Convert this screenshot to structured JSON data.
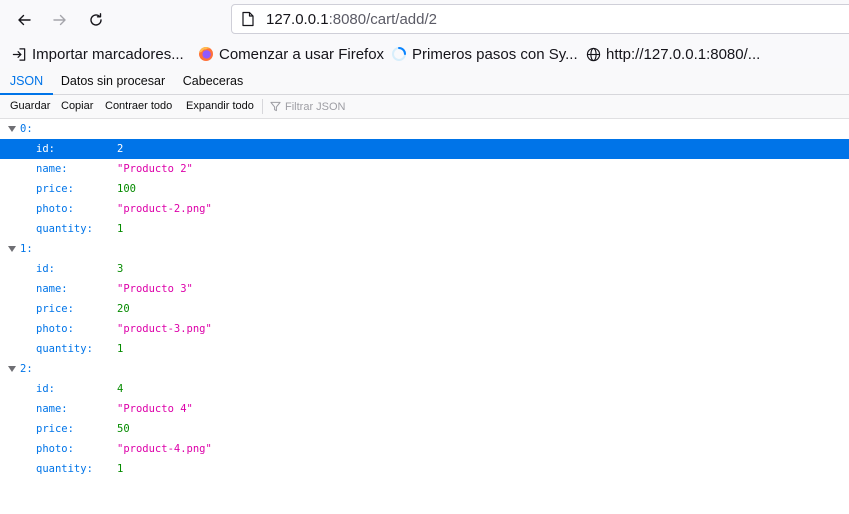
{
  "browser": {
    "url_host": "127.0.0.1",
    "url_rest": ":8080/cart/add/2",
    "bookmarks": [
      {
        "label": "Importar marcadores...",
        "icon": "import-icon"
      },
      {
        "label": "Comenzar a usar Firefox",
        "icon": "firefox-icon"
      },
      {
        "label": "Primeros pasos con Sy...",
        "icon": "spinner-icon"
      },
      {
        "label": "http://127.0.0.1:8080/...",
        "icon": "globe-icon"
      }
    ]
  },
  "viewer": {
    "tabs": [
      "JSON",
      "Datos sin procesar",
      "Cabeceras"
    ],
    "toolbar": {
      "save": "Guardar",
      "copy": "Copiar",
      "collapse": "Contraer todo",
      "expand": "Expandir todo",
      "filter_placeholder": "Filtrar JSON"
    }
  },
  "items": [
    {
      "index": "0:",
      "id": "2",
      "name": "\"Producto 2\"",
      "price": "100",
      "photo": "\"product-2.png\"",
      "quantity": "1"
    },
    {
      "index": "1:",
      "id": "3",
      "name": "\"Producto 3\"",
      "price": "20",
      "photo": "\"product-3.png\"",
      "quantity": "1"
    },
    {
      "index": "2:",
      "id": "4",
      "name": "\"Producto 4\"",
      "price": "50",
      "photo": "\"product-4.png\"",
      "quantity": "1"
    }
  ],
  "labels": {
    "id": "id:",
    "name": "name:",
    "price": "price:",
    "photo": "photo:",
    "quantity": "quantity:"
  },
  "colors": {
    "accent": "#0074e8",
    "number": "#058b00",
    "string": "#dd00a9"
  }
}
